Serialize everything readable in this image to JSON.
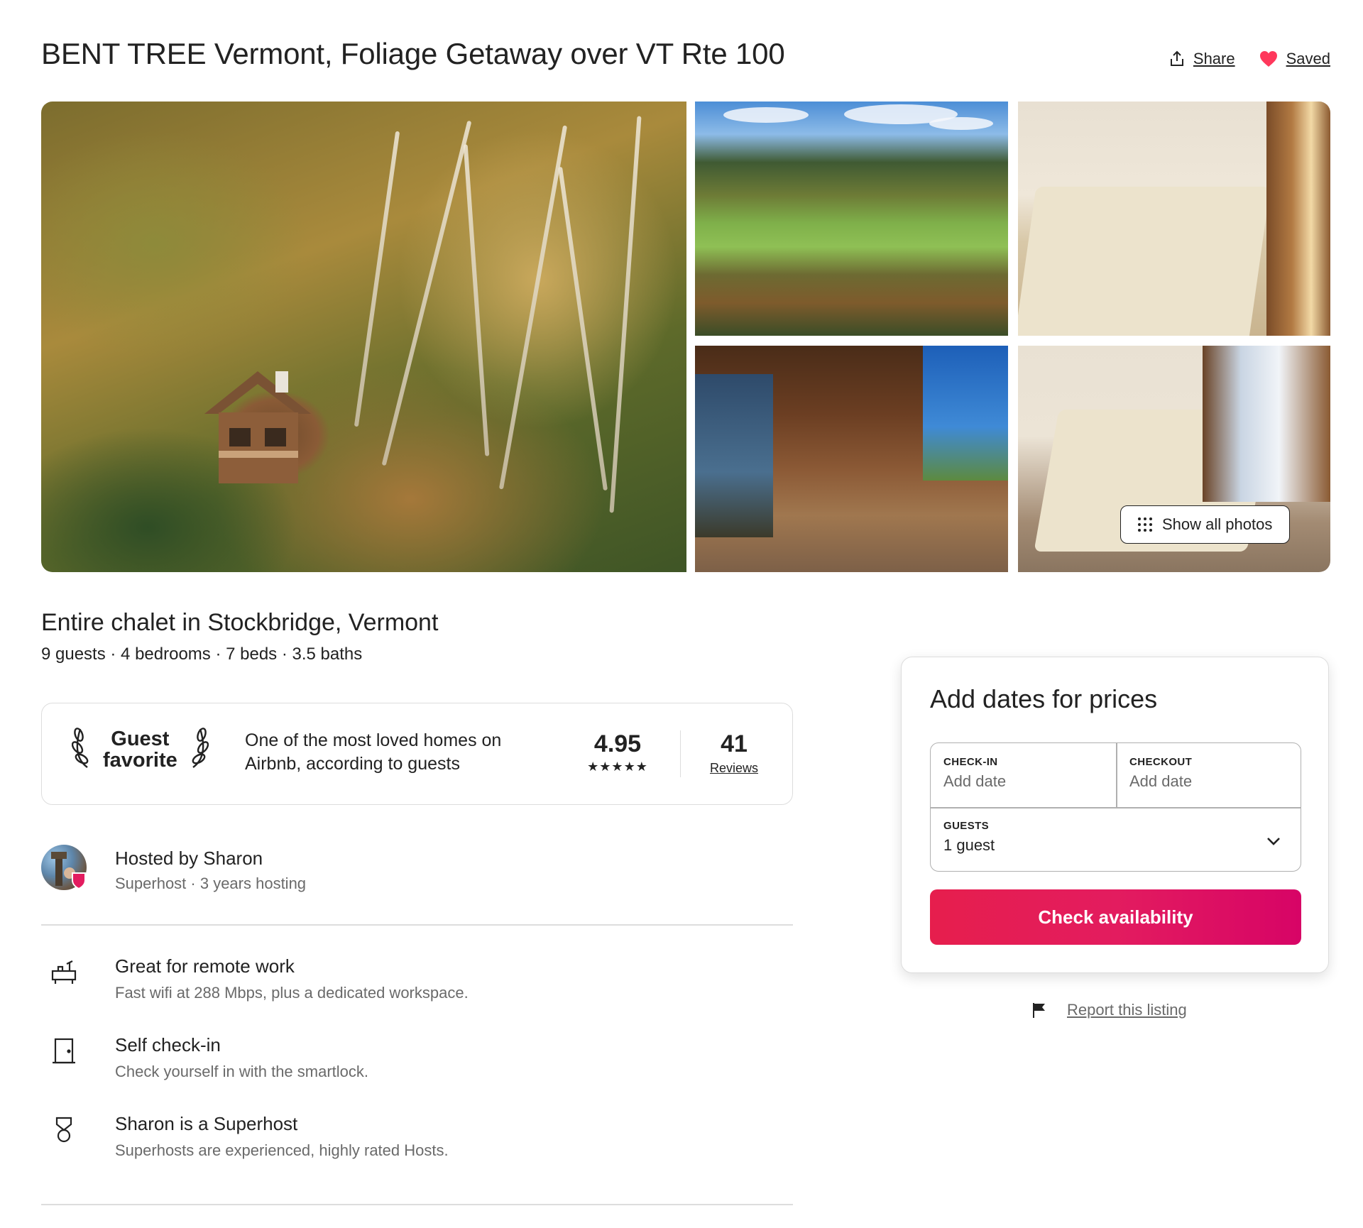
{
  "listing": {
    "title": "BENT TREE Vermont, Foliage Getaway over VT Rte 100",
    "share_label": "Share",
    "saved_label": "Saved",
    "show_all_photos_label": "Show all photos",
    "subtitle": "Entire chalet in Stockbridge, Vermont",
    "specs": "9 guests · 4 bedrooms · 7 beds · 3.5 baths"
  },
  "guest_favorite": {
    "badge_line1": "Guest",
    "badge_line2": "favorite",
    "description_line1": "One of the most loved homes on",
    "description_line2": "Airbnb, according to guests",
    "rating": "4.95",
    "stars": "★★★★★",
    "review_count": "41",
    "reviews_label": "Reviews"
  },
  "host": {
    "name_line": "Hosted by Sharon",
    "sub_line": "Superhost · 3 years hosting"
  },
  "highlights": [
    {
      "icon": "desk-icon",
      "title": "Great for remote work",
      "subtitle": "Fast wifi at 288 Mbps, plus a dedicated workspace."
    },
    {
      "icon": "door-icon",
      "title": "Self check-in",
      "subtitle": "Check yourself in with the smartlock."
    },
    {
      "icon": "superhost-medal-icon",
      "title": "Sharon is a Superhost",
      "subtitle": "Superhosts are experienced, highly rated Hosts."
    }
  ],
  "booking": {
    "heading": "Add dates for prices",
    "checkin_label": "CHECK-IN",
    "checkin_value": "Add date",
    "checkout_label": "CHECKOUT",
    "checkout_value": "Add date",
    "guests_label": "GUESTS",
    "guests_value": "1 guest",
    "button_label": "Check availability"
  },
  "report_label": "Report this listing",
  "colors": {
    "brand": "#e31c5f",
    "heart": "#ff385c",
    "text": "#222222",
    "muted": "#6a6a6a",
    "border": "#dddddd"
  }
}
